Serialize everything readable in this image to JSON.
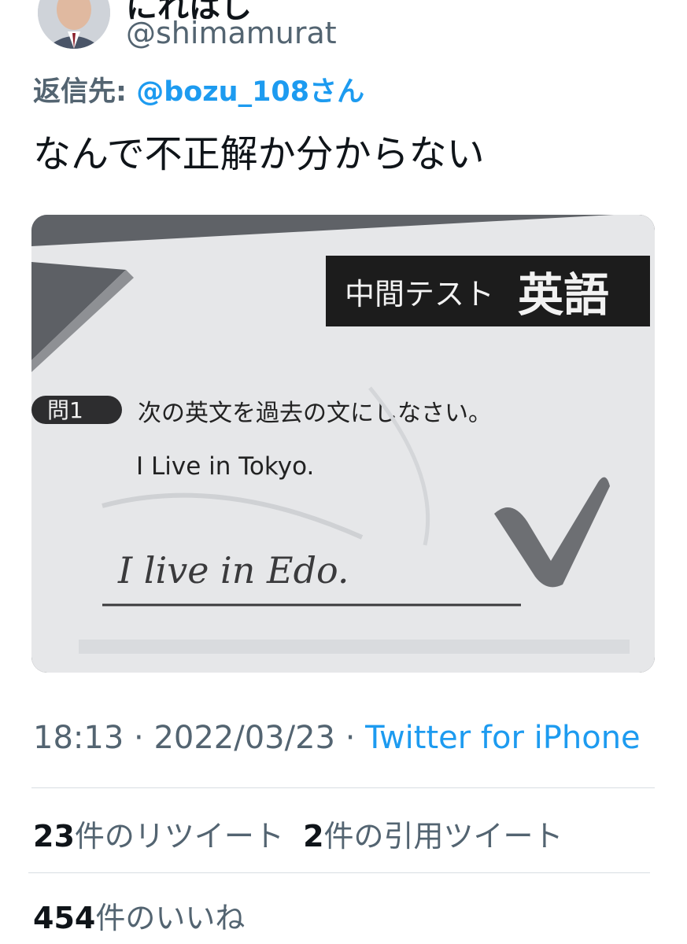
{
  "tweet": {
    "display_name": "にれはし",
    "handle": "@shimamurat",
    "reply_prefix": "返信先: ",
    "reply_to": "@bozu_108さん",
    "text": "なんで不正解か分からない",
    "time": "18:13",
    "date": "2022/03/23",
    "separator": " · ",
    "source": "Twitter for iPhone"
  },
  "media": {
    "header_small": "中間テスト",
    "header_large": "英語",
    "question_badge": "問1",
    "question_text": "次の英文を過去の文にしなさい。",
    "prompt_sentence": "I Live in Tokyo.",
    "handwritten_answer": "I  live  in  Edo."
  },
  "stats": {
    "retweets_count": "23",
    "retweets_label": "件のリツイート",
    "quotes_count": "2",
    "quotes_label": "件の引用ツイート",
    "likes_count": "454",
    "likes_label": "件のいいね"
  },
  "colors": {
    "link": "#1d9bf0",
    "secondary_text": "#536471",
    "primary_text": "#0f1419"
  }
}
